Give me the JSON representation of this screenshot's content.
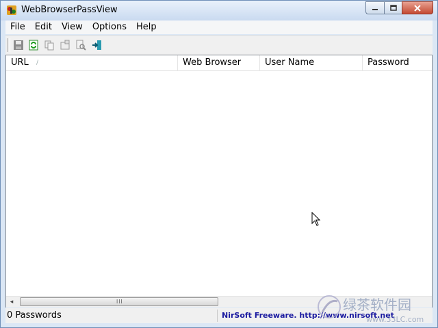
{
  "window": {
    "title": "WebBrowserPassView"
  },
  "menu": [
    {
      "label": "File"
    },
    {
      "label": "Edit"
    },
    {
      "label": "View"
    },
    {
      "label": "Options"
    },
    {
      "label": "Help"
    }
  ],
  "toolbar": {
    "icons": [
      "save-icon",
      "refresh-icon",
      "copy-icon",
      "properties-icon",
      "find-icon",
      "exit-icon"
    ]
  },
  "list": {
    "columns": [
      {
        "label": "URL"
      },
      {
        "label": "Web Browser"
      },
      {
        "label": "User Name"
      },
      {
        "label": "Password"
      }
    ],
    "sort_indicator": "/",
    "rows": []
  },
  "status": {
    "count_text": "0 Passwords",
    "link_text": "NirSoft Freeware.  http://www.nirsoft.net"
  },
  "watermark": {
    "text": "绿茶软件园",
    "url": "www.33LC.com"
  },
  "colors": {
    "link": "#1a1aa0",
    "close_button": "#c44a33",
    "titlebar": "#c9daf0"
  }
}
